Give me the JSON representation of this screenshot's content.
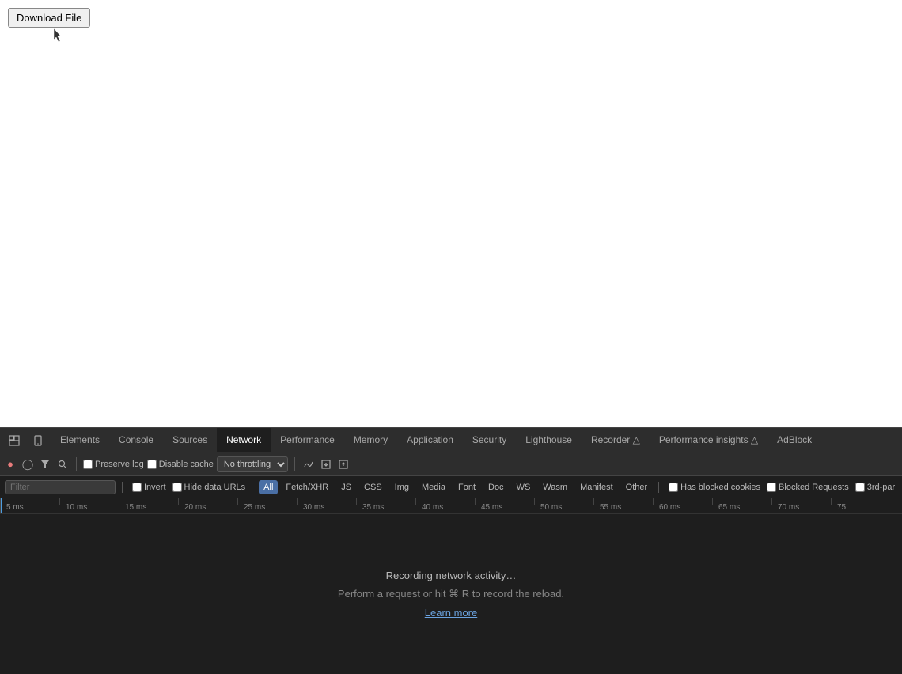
{
  "page": {
    "title": "Download File",
    "background": "#ffffff"
  },
  "download_button": {
    "label": "Download File"
  },
  "devtools": {
    "tabs": [
      {
        "id": "elements",
        "label": "Elements",
        "active": false
      },
      {
        "id": "console",
        "label": "Console",
        "active": false
      },
      {
        "id": "sources",
        "label": "Sources",
        "active": false
      },
      {
        "id": "network",
        "label": "Network",
        "active": true
      },
      {
        "id": "performance",
        "label": "Performance",
        "active": false
      },
      {
        "id": "memory",
        "label": "Memory",
        "active": false
      },
      {
        "id": "application",
        "label": "Application",
        "active": false
      },
      {
        "id": "security",
        "label": "Security",
        "active": false
      },
      {
        "id": "lighthouse",
        "label": "Lighthouse",
        "active": false
      },
      {
        "id": "recorder",
        "label": "Recorder",
        "active": false
      },
      {
        "id": "performance-insights",
        "label": "Performance insights",
        "active": false
      },
      {
        "id": "adblock",
        "label": "AdBlock",
        "active": false
      }
    ],
    "toolbar": {
      "preserve_log_label": "Preserve log",
      "disable_cache_label": "Disable cache",
      "throttle_value": "No throttling"
    },
    "filter": {
      "placeholder": "Filter",
      "invert_label": "Invert",
      "hide_data_urls_label": "Hide data URLs",
      "types": [
        "All",
        "Fetch/XHR",
        "JS",
        "CSS",
        "Img",
        "Media",
        "Font",
        "Doc",
        "WS",
        "Wasm",
        "Manifest",
        "Other"
      ],
      "active_type": "All",
      "has_blocked_cookies_label": "Has blocked cookies",
      "blocked_requests_label": "Blocked Requests",
      "third_party_label": "3rd-par"
    },
    "timeline": {
      "ticks": [
        "5 ms",
        "10 ms",
        "15 ms",
        "20 ms",
        "25 ms",
        "30 ms",
        "35 ms",
        "40 ms",
        "45 ms",
        "50 ms",
        "55 ms",
        "60 ms",
        "65 ms",
        "70 ms",
        "75"
      ]
    },
    "network_panel": {
      "recording_text": "Recording network activity…",
      "hint_text": "Perform a request or hit ⌘ R to record the reload.",
      "learn_more_label": "Learn more"
    }
  }
}
